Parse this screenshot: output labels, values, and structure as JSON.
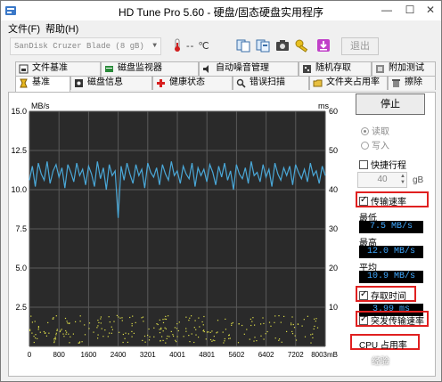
{
  "window": {
    "title": "HD Tune Pro 5.60 - 硬盘/固态硬盘实用程序",
    "minimize_glyph": "—",
    "maximize_glyph": "☐",
    "close_glyph": "✕"
  },
  "menu": {
    "file": "文件(F)",
    "help": "帮助(H)"
  },
  "toolbar": {
    "drive": "SanDisk Cruzer Blade (8 gB)",
    "temperature": "-- ℃",
    "exit_label": "退出",
    "icons": [
      "info-copy-icon",
      "save-screenshot-icon",
      "camera-icon",
      "key-icon",
      "download-icon"
    ]
  },
  "tabs_top": [
    {
      "label": "文件基准",
      "icon": "file-benchmark-icon"
    },
    {
      "label": "磁盘监视器",
      "icon": "disk-monitor-icon"
    },
    {
      "label": "自动噪音管理",
      "icon": "noise-icon"
    },
    {
      "label": "随机存取",
      "icon": "random-access-icon"
    },
    {
      "label": "附加测试",
      "icon": "extra-tests-icon"
    }
  ],
  "tabs_bottom": [
    {
      "label": "基准",
      "icon": "benchmark-icon",
      "active": true
    },
    {
      "label": "磁盘信息",
      "icon": "disk-info-icon"
    },
    {
      "label": "健康状态",
      "icon": "health-icon"
    },
    {
      "label": "错误扫描",
      "icon": "error-scan-icon"
    },
    {
      "label": "文件夹占用率",
      "icon": "folder-usage-icon"
    },
    {
      "label": "擦除",
      "icon": "erase-icon"
    }
  ],
  "side": {
    "stop_label": "停止",
    "read_label": "读取",
    "write_label": "写入",
    "short_stroke_label": "快捷行程",
    "short_stroke_value": "40",
    "unit_gb": "gB",
    "transfer_rate_label": "传输速率",
    "min_label": "最低",
    "min_value": "7.5 MB/s",
    "max_label": "最高",
    "max_value": "12.0 MB/s",
    "avg_label": "平均",
    "avg_value": "10.9 MB/s",
    "access_time_label": "存取时间",
    "access_time_value": "3.99 ms",
    "burst_rate_label": "突发传输速率",
    "cpu_usage_label": "CPU 占用率"
  },
  "watermark": {
    "text": "经验"
  },
  "colors": {
    "transfer_line": "#4aa8d8",
    "access_dots": "#e0e04a",
    "chart_bg": "#2a2a2a",
    "grid": "#5a5a5a",
    "highlight": "#e02020",
    "readout_text": "#3fa8ff"
  },
  "chart_data": {
    "type": "line",
    "ylabel_left": "MB/s",
    "ylabel_right": "ms",
    "ylim_left": [
      0,
      15
    ],
    "ylim_right": [
      0,
      60
    ],
    "yticks_left": [
      "15.0",
      "12.5",
      "10.0",
      "7.5",
      "5.0",
      "2.5"
    ],
    "yticks_right": [
      "60",
      "50",
      "40",
      "30",
      "20",
      "10"
    ],
    "xlim": [
      0,
      8003
    ],
    "xticks": [
      "0",
      "800",
      "1600",
      "2400",
      "3201",
      "4001",
      "4801",
      "5602",
      "6402",
      "7202",
      "8003mB"
    ],
    "grid": true,
    "series": [
      {
        "axis": "left",
        "x": [
          0,
          80,
          160,
          240,
          320,
          400,
          480,
          560,
          640,
          720,
          800,
          880,
          960,
          1040,
          1120,
          1200,
          1280,
          1360,
          1440,
          1520,
          1600,
          1680,
          1760,
          1840,
          1920,
          2000,
          2080,
          2160,
          2240,
          2320,
          2400,
          2480,
          2560,
          2640,
          2720,
          2800,
          2880,
          2960,
          3040,
          3120,
          3200,
          3280,
          3360,
          3440,
          3520,
          3600,
          3680,
          3760,
          3840,
          3920,
          4000,
          4080,
          4160,
          4240,
          4320,
          4400,
          4480,
          4560,
          4640,
          4720,
          4800,
          4880,
          4960,
          5040,
          5120,
          5200,
          5280,
          5360,
          5440,
          5520,
          5600,
          5680,
          5760,
          5840,
          5920,
          6000,
          6080,
          6160,
          6240,
          6320,
          6400,
          6480,
          6560,
          6640,
          6720,
          6800,
          6880,
          6960,
          7040,
          7120,
          7200,
          7280,
          7360,
          7440,
          7520,
          7600,
          7680,
          7760,
          7840,
          7920,
          8003
        ],
        "values": [
          10.6,
          11.5,
          10.2,
          11.7,
          11.0,
          10.6,
          11.8,
          10.4,
          11.2,
          11.6,
          10.8,
          11.4,
          10.1,
          11.6,
          11.1,
          10.5,
          11.7,
          10.9,
          11.3,
          10.3,
          11.5,
          11.0,
          10.2,
          11.8,
          10.7,
          11.4,
          10.0,
          11.6,
          10.9,
          11.2,
          8.2,
          11.5,
          10.6,
          11.7,
          11.0,
          10.4,
          11.6,
          10.9,
          11.3,
          10.1,
          11.7,
          11.1,
          10.8,
          11.4,
          10.3,
          11.6,
          11.0,
          10.6,
          11.8,
          10.9,
          11.2,
          10.4,
          11.5,
          11.0,
          10.7,
          11.7,
          10.2,
          11.4,
          10.9,
          11.3,
          10.5,
          11.6,
          11.1,
          10.3,
          11.5,
          10.8,
          11.7,
          10.6,
          11.2,
          10.0,
          11.6,
          11.0,
          10.7,
          11.4,
          10.4,
          11.8,
          10.9,
          11.1,
          10.5,
          11.6,
          10.8,
          11.3,
          10.2,
          11.7,
          11.0,
          10.6,
          11.4,
          10.9,
          11.5,
          10.3,
          11.6,
          11.1,
          10.7,
          11.3,
          10.5,
          11.7,
          10.9,
          11.2,
          10.4,
          11.5,
          10.9
        ]
      }
    ],
    "scatter_summary": {
      "axis": "right",
      "x_range": [
        0,
        8003
      ],
      "y_range_ms": [
        1,
        8
      ],
      "count": 260
    }
  }
}
